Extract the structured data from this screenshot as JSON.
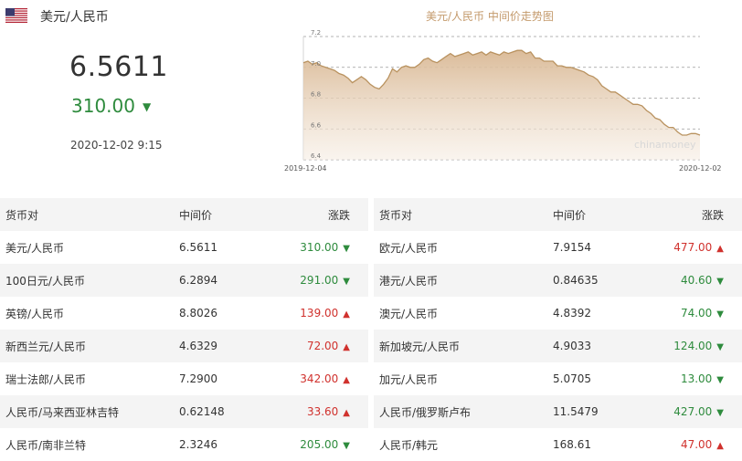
{
  "header": {
    "pair_title": "美元/人民币",
    "rate": "6.5611",
    "change": "310.00",
    "change_direction": "down",
    "timestamp": "2020-12-02 9:15"
  },
  "chart": {
    "title": "美元/人民币 中间价走势图",
    "watermark": "chinamoney",
    "area_color": "#d9b894",
    "chart_data": {
      "type": "area",
      "title": "美元/人民币 中间价走势图",
      "x_start": "2019-12-04",
      "x_end": "2020-12-02",
      "ylim": [
        6.4,
        7.2
      ],
      "yticks": [
        "7.2",
        "7.0",
        "6.8",
        "6.6",
        "6.4"
      ],
      "grid": true,
      "values": [
        7.03,
        7.04,
        7.02,
        7.03,
        7.01,
        7.0,
        6.99,
        6.98,
        6.96,
        6.95,
        6.93,
        6.9,
        6.92,
        6.94,
        6.92,
        6.89,
        6.87,
        6.86,
        6.89,
        6.93,
        6.99,
        6.97,
        7.0,
        7.01,
        7.0,
        7.0,
        7.02,
        7.05,
        7.06,
        7.04,
        7.03,
        7.05,
        7.07,
        7.09,
        7.07,
        7.08,
        7.09,
        7.1,
        7.08,
        7.09,
        7.1,
        7.08,
        7.1,
        7.09,
        7.08,
        7.1,
        7.09,
        7.1,
        7.11,
        7.11,
        7.09,
        7.1,
        7.06,
        7.06,
        7.04,
        7.04,
        7.04,
        7.01,
        7.01,
        7.0,
        7.0,
        6.99,
        6.98,
        6.97,
        6.95,
        6.94,
        6.92,
        6.88,
        6.86,
        6.84,
        6.84,
        6.82,
        6.8,
        6.78,
        6.76,
        6.76,
        6.75,
        6.72,
        6.7,
        6.67,
        6.66,
        6.63,
        6.61,
        6.61,
        6.58,
        6.56,
        6.56,
        6.57,
        6.57,
        6.56
      ]
    }
  },
  "tables": {
    "headers": {
      "pair": "货币对",
      "mid": "中间价",
      "change": "涨跌"
    },
    "left": [
      {
        "pair": "美元/人民币",
        "mid": "6.5611",
        "change": "310.00",
        "dir": "down"
      },
      {
        "pair": "100日元/人民币",
        "mid": "6.2894",
        "change": "291.00",
        "dir": "down"
      },
      {
        "pair": "英镑/人民币",
        "mid": "8.8026",
        "change": "139.00",
        "dir": "up"
      },
      {
        "pair": "新西兰元/人民币",
        "mid": "4.6329",
        "change": "72.00",
        "dir": "up"
      },
      {
        "pair": "瑞士法郎/人民币",
        "mid": "7.2900",
        "change": "342.00",
        "dir": "up"
      },
      {
        "pair": "人民币/马来西亚林吉特",
        "mid": "0.62148",
        "change": "33.60",
        "dir": "up"
      },
      {
        "pair": "人民币/南非兰特",
        "mid": "2.3246",
        "change": "205.00",
        "dir": "down"
      }
    ],
    "right": [
      {
        "pair": "欧元/人民币",
        "mid": "7.9154",
        "change": "477.00",
        "dir": "up"
      },
      {
        "pair": "港元/人民币",
        "mid": "0.84635",
        "change": "40.60",
        "dir": "down"
      },
      {
        "pair": "澳元/人民币",
        "mid": "4.8392",
        "change": "74.00",
        "dir": "down"
      },
      {
        "pair": "新加坡元/人民币",
        "mid": "4.9033",
        "change": "124.00",
        "dir": "down"
      },
      {
        "pair": "加元/人民币",
        "mid": "5.0705",
        "change": "13.00",
        "dir": "down"
      },
      {
        "pair": "人民币/俄罗斯卢布",
        "mid": "11.5479",
        "change": "427.00",
        "dir": "down"
      },
      {
        "pair": "人民币/韩元",
        "mid": "168.61",
        "change": "47.00",
        "dir": "up"
      }
    ]
  },
  "colors": {
    "up": "#d0312d",
    "down": "#2e8b3d",
    "header_bg": "#f4f4f4"
  },
  "icons": {
    "flag": "us-flag-icon",
    "up": "triangle-up-icon",
    "down": "triangle-down-icon"
  }
}
